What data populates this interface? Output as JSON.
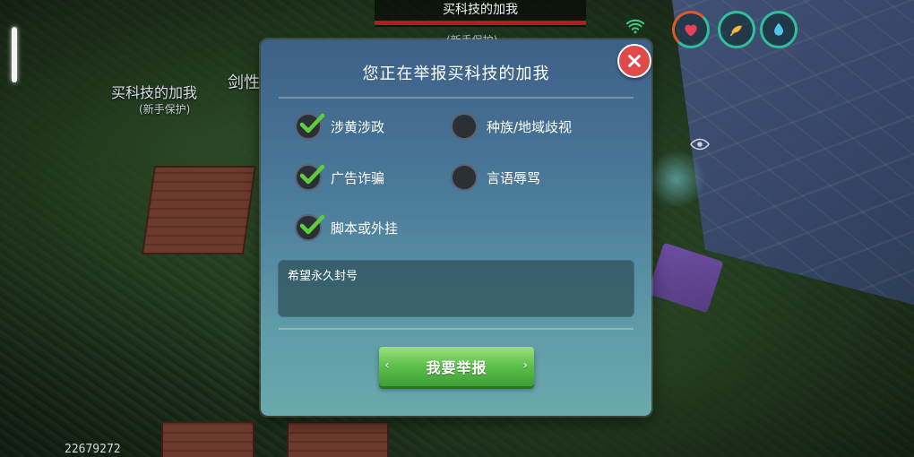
{
  "hud": {
    "top_player_name": "买科技的加我",
    "top_player_tag": "(新手保护)",
    "nearby_player_name": "买科技的加我",
    "nearby_player_tag": "(新手保护)",
    "partial_name": "剑性",
    "score": "22679272",
    "icons": [
      "wifi-icon",
      "heart-icon",
      "food-icon",
      "water-drop-icon",
      "eye-icon"
    ]
  },
  "dialog": {
    "title": "您正在举报买科技的加我",
    "close_icon": "close-icon",
    "options": [
      {
        "label": "涉黄涉政",
        "checked": true
      },
      {
        "label": "种族/地域歧视",
        "checked": false
      },
      {
        "label": "广告诈骗",
        "checked": true
      },
      {
        "label": "言语辱骂",
        "checked": false
      },
      {
        "label": "脚本或外挂",
        "checked": true
      }
    ],
    "reason_text": "希望永久封号",
    "submit_label": "我要举报"
  },
  "colors": {
    "check_green": "#5dcf3c",
    "close_red": "#e04a4a",
    "submit_green": "#5bbf4a",
    "hp_red": "#b41d1d"
  }
}
